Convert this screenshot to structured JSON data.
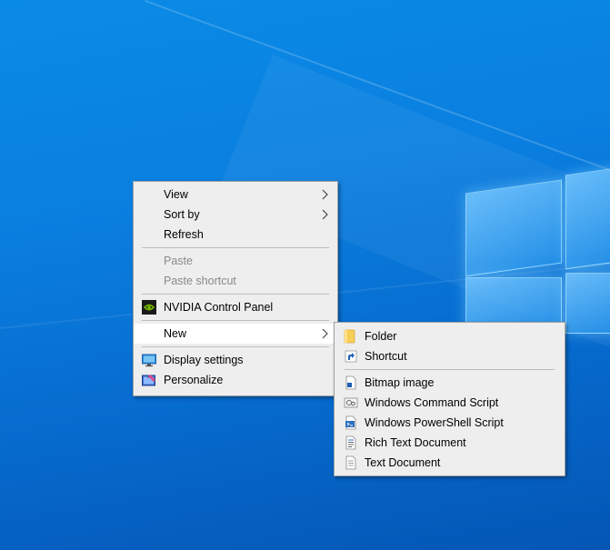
{
  "desktop": {
    "background_color": "#0a7fe0"
  },
  "context_menu": {
    "items": [
      {
        "label": "View",
        "submenu": true
      },
      {
        "label": "Sort by",
        "submenu": true
      },
      {
        "label": "Refresh"
      },
      {
        "label": "Paste",
        "disabled": true
      },
      {
        "label": "Paste shortcut",
        "disabled": true
      },
      {
        "label": "NVIDIA Control Panel",
        "icon": "nvidia-icon"
      },
      {
        "label": "New",
        "submenu": true,
        "active": true
      },
      {
        "label": "Display settings",
        "icon": "display-icon"
      },
      {
        "label": "Personalize",
        "icon": "personalize-icon"
      }
    ]
  },
  "new_submenu": {
    "items": [
      {
        "label": "Folder",
        "icon": "folder-icon"
      },
      {
        "label": "Shortcut",
        "icon": "shortcut-icon"
      },
      {
        "label": "Bitmap image",
        "icon": "bitmap-icon"
      },
      {
        "label": "Windows Command Script",
        "icon": "command-script-icon"
      },
      {
        "label": "Windows PowerShell Script",
        "icon": "powershell-script-icon"
      },
      {
        "label": "Rich Text Document",
        "icon": "rich-text-icon"
      },
      {
        "label": "Text Document",
        "icon": "text-document-icon"
      }
    ]
  }
}
